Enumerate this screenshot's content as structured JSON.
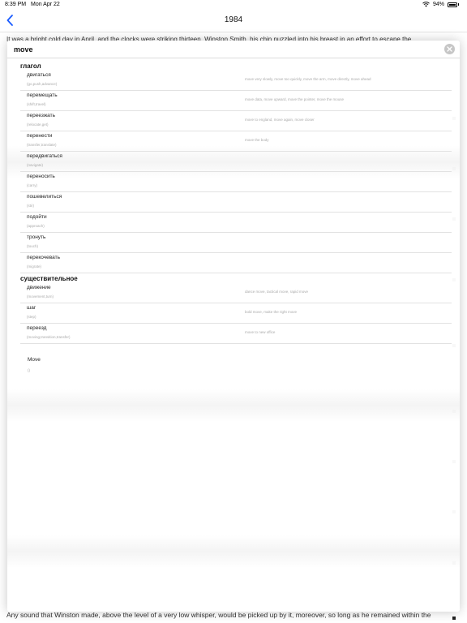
{
  "status": {
    "time": "8:39 PM",
    "date": "Mon Apr 22",
    "battery": "94%"
  },
  "nav": {
    "title": "1984"
  },
  "book": {
    "first_line": "It was a bright cold day in April, and the clocks were striking thirteen. Winston Smith, his chin nuzzled into his breast in an effort to escape the",
    "last_line": "Any sound that Winston made, above the level of a very low whisper, would be picked up by it, moreover, so long as he remained within the"
  },
  "popup": {
    "title": "move",
    "sections": [
      {
        "title": "глагол",
        "entries": [
          {
            "word": "двигаться",
            "synonyms": "(go,push,advance)",
            "examples": "move very slowly, move too quickly, move the arm, move directly, move ahead"
          },
          {
            "word": "перемещать",
            "synonyms": "(shift,travel)",
            "examples": "move data, move upward, move the pointer, move the mouse"
          },
          {
            "word": "переезжать",
            "synonyms": "(relocate,get)",
            "examples": "move to england, move again, move closer"
          },
          {
            "word": "перенести",
            "synonyms": "(transfer,translate)",
            "examples": "move the body"
          },
          {
            "word": "передвигаться",
            "synonyms": "(navigate)",
            "examples": ""
          },
          {
            "word": "переносить",
            "synonyms": "(carry)",
            "examples": ""
          },
          {
            "word": "пошевелиться",
            "synonyms": "(stir)",
            "examples": ""
          },
          {
            "word": "подойти",
            "synonyms": "(approach)",
            "examples": ""
          },
          {
            "word": "тронуть",
            "synonyms": "(touch)",
            "examples": ""
          },
          {
            "word": "перекочевать",
            "synonyms": "(migrate)",
            "examples": ""
          }
        ]
      },
      {
        "title": "существительное",
        "entries": [
          {
            "word": "движение",
            "synonyms": "(movement,turn)",
            "examples": "dance move, tactical move, rapid move"
          },
          {
            "word": "шаг",
            "synonyms": "(step)",
            "examples": "bold move, make the right move"
          },
          {
            "word": "переезд",
            "synonyms": "(moving,transition,transfer)",
            "examples": "move to new office"
          }
        ]
      }
    ],
    "footer": {
      "word": "Move",
      "sub": "()"
    }
  },
  "colors": {
    "accent": "#1a5cff",
    "close_button": "#c6c6c6"
  }
}
